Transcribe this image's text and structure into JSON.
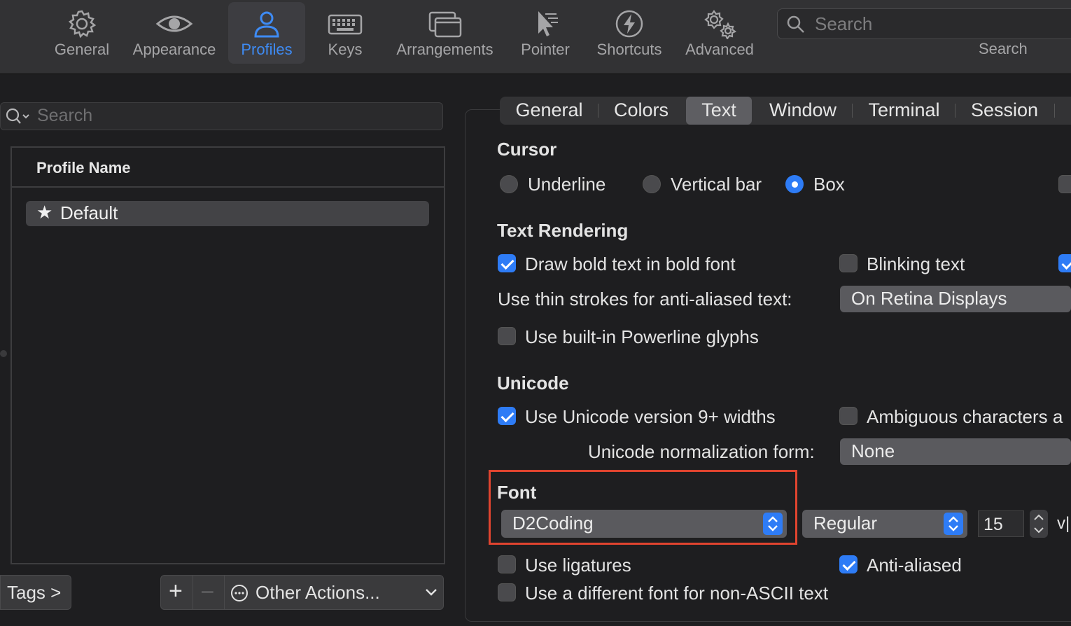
{
  "toolbar": {
    "items": [
      {
        "label": "General",
        "icon": "gear-icon"
      },
      {
        "label": "Appearance",
        "icon": "eye-icon"
      },
      {
        "label": "Profiles",
        "icon": "person-icon",
        "active": true
      },
      {
        "label": "Keys",
        "icon": "keyboard-icon"
      },
      {
        "label": "Arrangements",
        "icon": "windows-icon"
      },
      {
        "label": "Pointer",
        "icon": "pointer-icon"
      },
      {
        "label": "Shortcuts",
        "icon": "bolt-icon"
      },
      {
        "label": "Advanced",
        "icon": "gears-icon"
      }
    ],
    "search_placeholder": "Search",
    "search_label": "Search"
  },
  "profiles": {
    "search_placeholder": "Search",
    "column_header": "Profile Name",
    "rows": [
      {
        "name": "Default",
        "starred": true
      }
    ],
    "tags_button": "Tags >",
    "add_button": "+",
    "remove_button": "–",
    "other_actions": "Other Actions..."
  },
  "tabs": [
    "General",
    "Colors",
    "Text",
    "Window",
    "Terminal",
    "Session"
  ],
  "selected_tab": "Text",
  "cursor": {
    "heading": "Cursor",
    "options": [
      "Underline",
      "Vertical bar",
      "Box"
    ],
    "selected": "Box"
  },
  "text_rendering": {
    "heading": "Text Rendering",
    "draw_bold": {
      "label": "Draw bold text in bold font",
      "checked": true
    },
    "blinking": {
      "label": "Blinking text",
      "checked": false
    },
    "thin_strokes_label": "Use thin strokes for anti-aliased text:",
    "thin_strokes_value": "On Retina Displays",
    "powerline": {
      "label": "Use built-in Powerline glyphs",
      "checked": false
    }
  },
  "unicode": {
    "heading": "Unicode",
    "widths": {
      "label": "Use Unicode version 9+ widths",
      "checked": true
    },
    "ambiguous": {
      "label": "Ambiguous characters a",
      "checked": false
    },
    "normalization_label": "Unicode normalization form:",
    "normalization_value": "None"
  },
  "font": {
    "heading": "Font",
    "family": "D2Coding",
    "style": "Regular",
    "size": "15",
    "spacing_label": "v|",
    "ligatures": {
      "label": "Use ligatures",
      "checked": false
    },
    "anti_aliased": {
      "label": "Anti-aliased",
      "checked": true
    },
    "non_ascii": {
      "label": "Use a different font for non-ASCII text",
      "checked": false
    }
  },
  "colors": {
    "accent": "#2e7cf6",
    "highlight_box": "#e0442f"
  }
}
